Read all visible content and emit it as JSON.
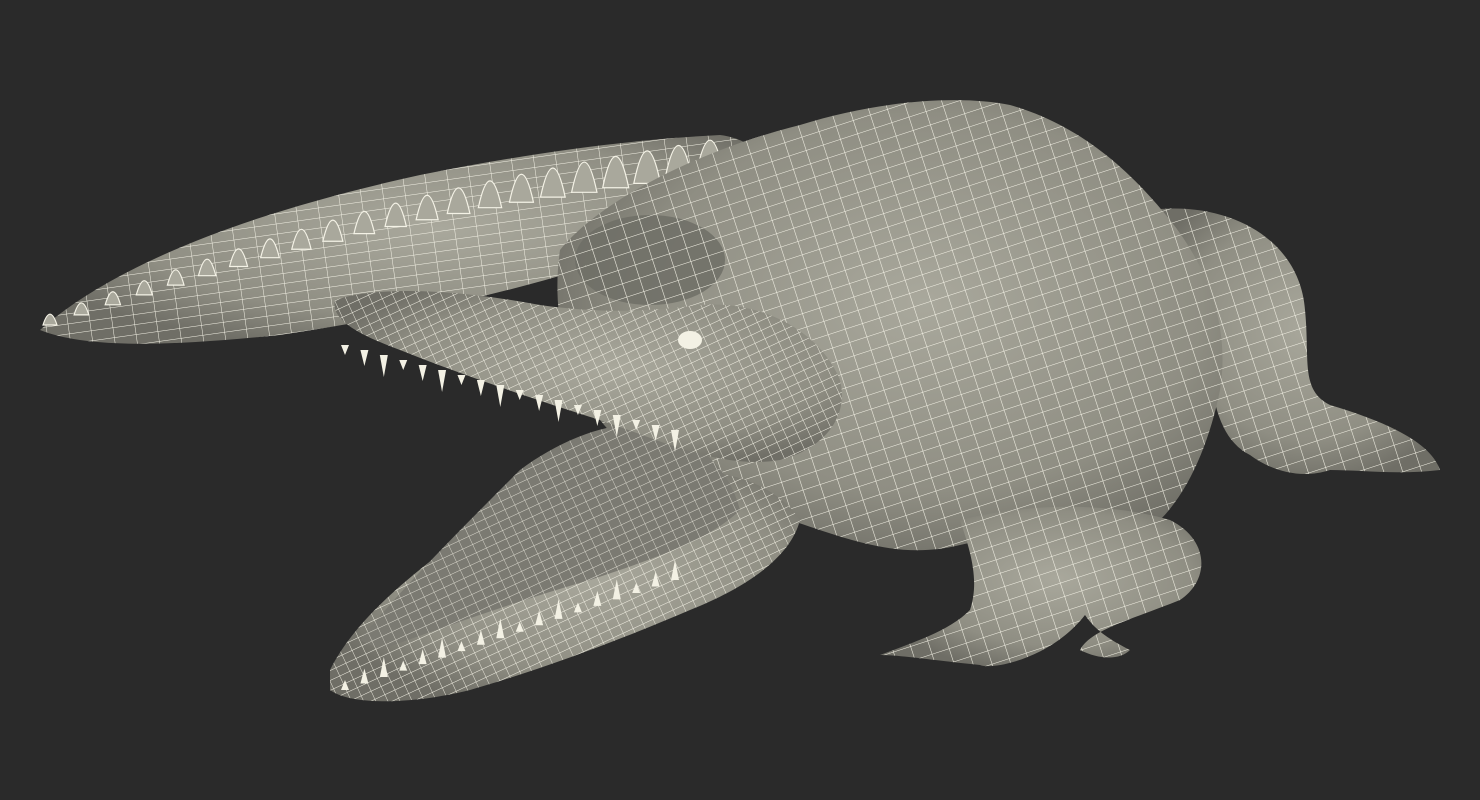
{
  "scene": {
    "subject": "crocodile-wireframe-model",
    "colors": {
      "background": "#2a2a2a",
      "mesh_fill": "#8f8e83",
      "mesh_fill_light": "#a9a89c",
      "mesh_fill_dark": "#6f6e66",
      "wire": "#f4f2e6",
      "teeth": "#f3f1e4",
      "mouth_inner": "#7b7a72"
    }
  }
}
